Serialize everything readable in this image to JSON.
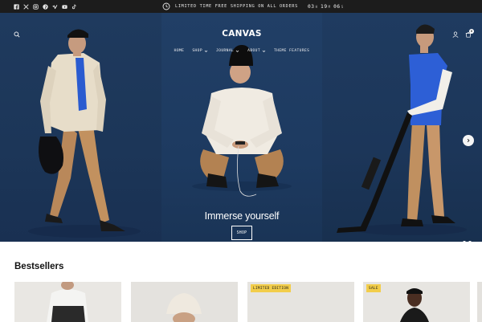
{
  "announcement": {
    "text": "LIMITED TIME FREE SHIPPING ON ALL ORDERS",
    "timer": [
      {
        "value": "03",
        "unit": "H"
      },
      {
        "value": "19",
        "unit": "M"
      },
      {
        "value": "06",
        "unit": "S"
      }
    ]
  },
  "social_icons": [
    "facebook-icon",
    "x-icon",
    "instagram-icon",
    "pinterest-icon",
    "vimeo-icon",
    "youtube-icon",
    "tiktok-icon"
  ],
  "header": {
    "logo": "CANVAS",
    "nav": [
      {
        "label": "HOME",
        "dropdown": false
      },
      {
        "label": "SHOP",
        "dropdown": true
      },
      {
        "label": "JOURNAL",
        "dropdown": true
      },
      {
        "label": "ABOUT",
        "dropdown": true
      },
      {
        "label": "THEME FEATURES",
        "dropdown": false
      }
    ],
    "cart_count": "0"
  },
  "hero": {
    "title": "Immerse yourself",
    "button": "SHOP",
    "slide_count": 2,
    "active_slide": 1
  },
  "bestsellers": {
    "title": "Bestsellers",
    "products": [
      {
        "badge": ""
      },
      {
        "badge": ""
      },
      {
        "badge": "LIMITED EDITION"
      },
      {
        "badge": "SALE"
      }
    ]
  },
  "colors": {
    "topbar": "#1c1c1c",
    "hero_blue": "#1f3a5e",
    "badge": "#f2cd4a"
  }
}
